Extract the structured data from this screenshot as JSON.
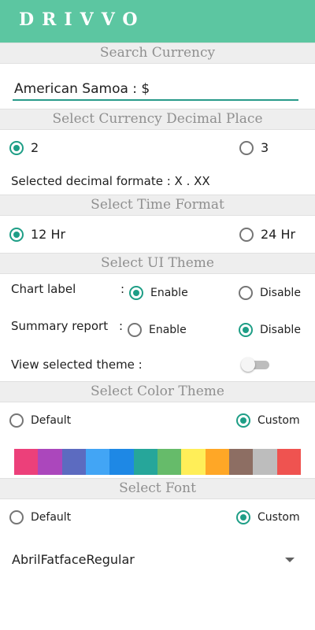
{
  "app": {
    "title": "DRIVVO"
  },
  "search": {
    "header": "Search Currency",
    "value": "American Samoa : $"
  },
  "decimal": {
    "header": "Select Currency Decimal Place",
    "option_2": "2",
    "option_3": "3",
    "selected": "2",
    "info": "Selected decimal formate : X . XX"
  },
  "time_format": {
    "header": "Select Time Format",
    "option_12": "12 Hr",
    "option_24": "24 Hr",
    "selected": "12 Hr"
  },
  "ui_theme": {
    "header": "Select UI Theme",
    "chart_label": {
      "label": "Chart label",
      "colon": ":",
      "enable": "Enable",
      "disable": "Disable",
      "selected": "Enable"
    },
    "summary_report": {
      "label": "Summary report",
      "colon": ":",
      "enable": "Enable",
      "disable": "Disable",
      "selected": "Disable"
    },
    "view_selected_theme": {
      "label": "View selected theme :",
      "on": false
    }
  },
  "color_theme": {
    "header": "Select Color Theme",
    "option_default": "Default",
    "option_custom": "Custom",
    "selected": "Custom",
    "swatches": [
      "#ec407a",
      "#ab47bc",
      "#5c6bc0",
      "#42a5f5",
      "#1e88e5",
      "#26a69a",
      "#66bb6a",
      "#ffee58",
      "#ffa726",
      "#8d6e63",
      "#bdbdbd",
      "#ef5350"
    ]
  },
  "font": {
    "header": "Select Font",
    "option_default": "Default",
    "option_custom": "Custom",
    "selected": "Custom",
    "value": "AbrilFatfaceRegular"
  },
  "colors": {
    "primary": "#5cc6a1",
    "accent": "#1e9e86",
    "header_bg": "#eeeeee",
    "header_text": "#8f8f8f"
  }
}
